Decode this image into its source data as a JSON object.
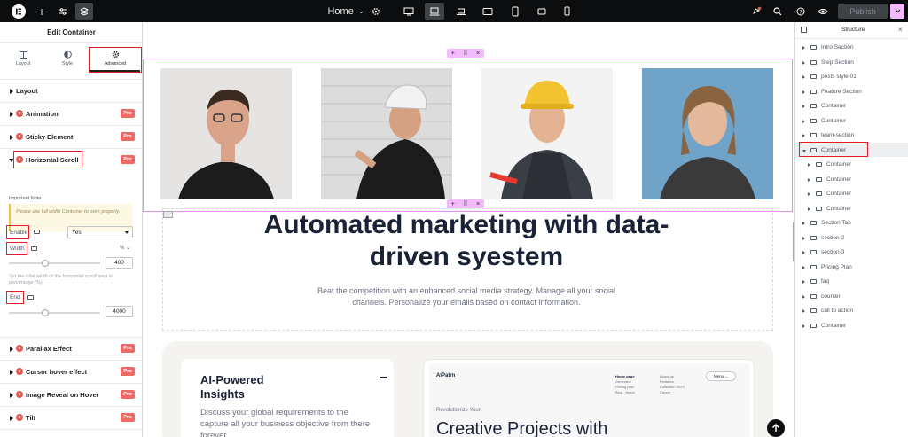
{
  "topbar": {
    "page_name": "Home",
    "publish_label": "Publish"
  },
  "left_panel": {
    "title": "Edit Container",
    "tabs": [
      {
        "label": "Layout",
        "icon": "layout-icon"
      },
      {
        "label": "Style",
        "icon": "half-circle-icon"
      },
      {
        "label": "Advanced",
        "icon": "gear-icon"
      }
    ],
    "sections": {
      "layout": "Layout",
      "animation": "Animation",
      "sticky": "Sticky Element",
      "hscroll": "Horizontal Scroll",
      "parallax": "Parallax Effect",
      "cursor": "Cursor hover effect",
      "reveal": "Image Reveal on Hover",
      "tilt": "Tilt"
    },
    "pro_label": "Pro",
    "important_note_label": "Important Note",
    "important_note_text": "Please use full width Container to work properly.",
    "enable_label": "Enable",
    "enable_value": "Yes",
    "width_label": "Width",
    "width_unit": "% ⌄",
    "width_value": "400",
    "width_description": "Set the total width of the horizontal scroll area in percentage (%)",
    "end_label": "End",
    "end_value": "4000"
  },
  "canvas": {
    "headline": "Automated marketing with data-driven syestem",
    "subtext": "Beat the competition with an enhanced social media strategy. Manage all your social channels. Personalize your emails based on contact information.",
    "card1_title": "AI-Powered Insights",
    "card1_text": "Discuss your global requirements to the capture all your business objective from there forever",
    "mock": {
      "logo": "AIPatrn",
      "nav_col1": [
        "Home page",
        "Generator",
        "Pricing plan",
        "Blog - News"
      ],
      "nav_col2": [
        "About us",
        "Features",
        "Collection 2023",
        "Career"
      ],
      "menu_label": "Menu",
      "revolutionize": "Revolutionize Your",
      "creative": "Creative Projects with"
    }
  },
  "structure": {
    "title": "Structure",
    "items": [
      {
        "label": "Intro Section",
        "indent": 0,
        "expanded": false
      },
      {
        "label": "Step Section",
        "indent": 0,
        "expanded": false
      },
      {
        "label": "posts style 01",
        "indent": 0,
        "expanded": false
      },
      {
        "label": "Feature Section",
        "indent": 0,
        "expanded": false
      },
      {
        "label": "Container",
        "indent": 0,
        "expanded": false
      },
      {
        "label": "Container",
        "indent": 0,
        "expanded": false
      },
      {
        "label": "team-section",
        "indent": 0,
        "expanded": false
      },
      {
        "label": "Container",
        "indent": 0,
        "expanded": true
      },
      {
        "label": "Container",
        "indent": 1,
        "expanded": false
      },
      {
        "label": "Container",
        "indent": 1,
        "expanded": false
      },
      {
        "label": "Container",
        "indent": 1,
        "expanded": false
      },
      {
        "label": "Container",
        "indent": 1,
        "expanded": false
      },
      {
        "label": "Section Tab",
        "indent": 0,
        "expanded": false
      },
      {
        "label": "section-2",
        "indent": 0,
        "expanded": false
      },
      {
        "label": "section-3",
        "indent": 0,
        "expanded": false
      },
      {
        "label": "Pricing Plan",
        "indent": 0,
        "expanded": false
      },
      {
        "label": "faq",
        "indent": 0,
        "expanded": false
      },
      {
        "label": "counter",
        "indent": 0,
        "expanded": false
      },
      {
        "label": "call to action",
        "indent": 0,
        "expanded": false
      },
      {
        "label": "Container",
        "indent": 0,
        "expanded": false
      }
    ]
  },
  "colors": {
    "accent_pink": "#f3bafd",
    "pro_badge": "#ed6a67",
    "highlight_red": "#e31e24",
    "topbar": "#0c0d0e"
  }
}
